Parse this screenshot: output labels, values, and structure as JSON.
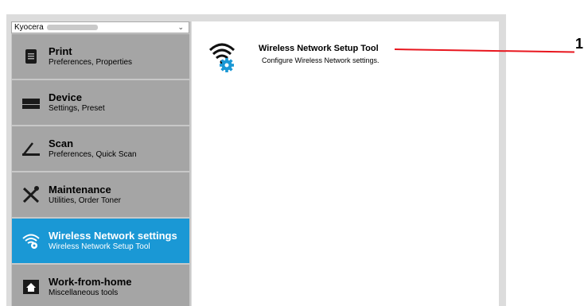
{
  "printer_select": {
    "value": "Kyocera"
  },
  "sidebar": {
    "items": [
      {
        "title": "Print",
        "subtitle": "Preferences, Properties",
        "icon": "print-icon",
        "active": false
      },
      {
        "title": "Device",
        "subtitle": "Settings, Preset",
        "icon": "device-icon",
        "active": false
      },
      {
        "title": "Scan",
        "subtitle": "Preferences, Quick Scan",
        "icon": "scan-icon",
        "active": false
      },
      {
        "title": "Maintenance",
        "subtitle": "Utilities, Order Toner",
        "icon": "maintenance-icon",
        "active": false
      },
      {
        "title": "Wireless Network settings",
        "subtitle": "Wireless Network Setup Tool",
        "icon": "wireless-settings-icon",
        "active": true
      },
      {
        "title": "Work-from-home",
        "subtitle": "Miscellaneous tools",
        "icon": "work-from-home-icon",
        "active": false
      }
    ]
  },
  "main": {
    "tool": {
      "title": "Wireless Network Setup Tool",
      "description": "Configure Wireless Network settings.",
      "icon": "wireless-gear-icon"
    }
  },
  "callout": {
    "number": "1"
  },
  "colors": {
    "active_item": "#1a98d5",
    "item_bg": "#a5a5a5",
    "callout_line": "#e8161e"
  }
}
